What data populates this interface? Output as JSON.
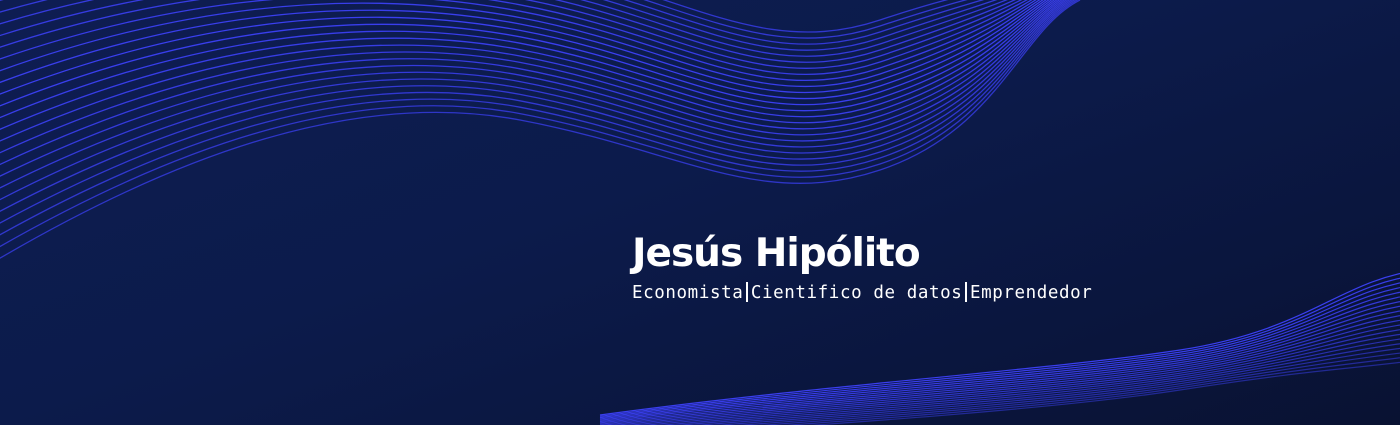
{
  "profile": {
    "name": "Jesús Hipólito",
    "roles": [
      "Economista",
      "Cientifico de datos",
      "Emprendedor"
    ]
  },
  "colors": {
    "background": "#0c1b4b",
    "wave_lines": "#3a3ff0",
    "text": "#ffffff"
  }
}
